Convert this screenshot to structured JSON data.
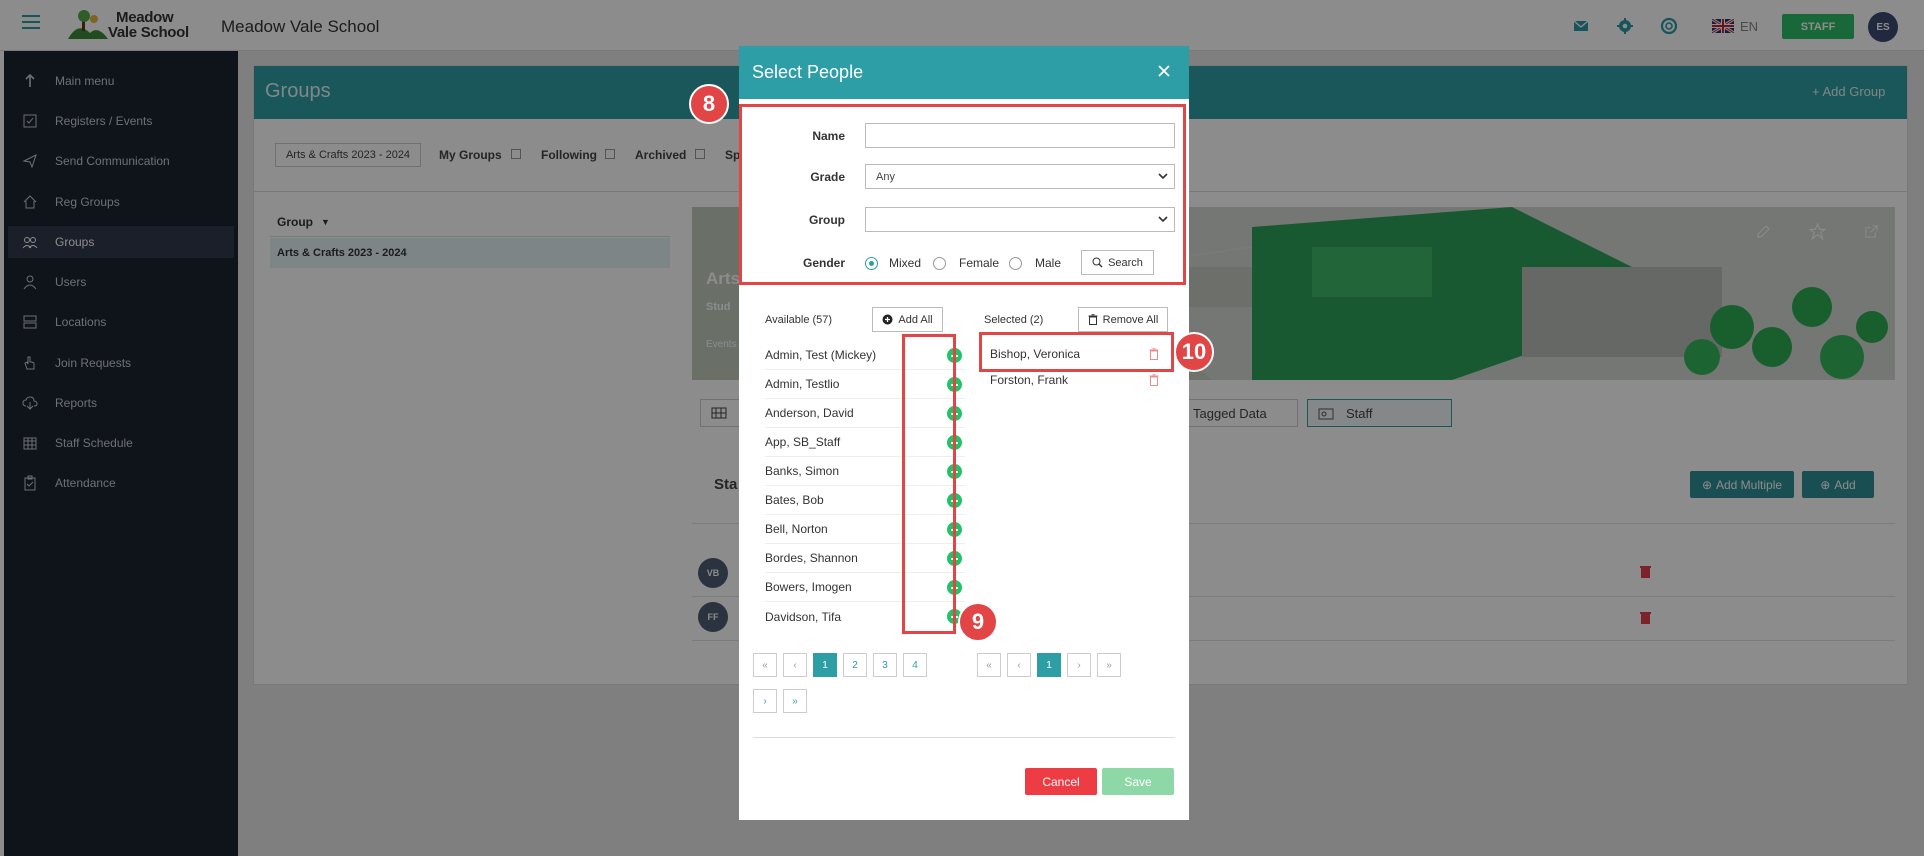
{
  "app": {
    "logo_line1": "Meadow",
    "logo_line2": "Vale School",
    "school_name": "Meadow Vale School",
    "language": "EN",
    "role_badge": "STAFF",
    "user_initials": "ES"
  },
  "sidebar": {
    "items": [
      {
        "label": "Main menu",
        "icon": "arrow-up-icon"
      },
      {
        "label": "Registers / Events",
        "icon": "checkbox-icon"
      },
      {
        "label": "Send Communication",
        "icon": "send-icon"
      },
      {
        "label": "Reg Groups",
        "icon": "home-icon"
      },
      {
        "label": "Groups",
        "icon": "people-icon"
      },
      {
        "label": "Users",
        "icon": "user-icon"
      },
      {
        "label": "Locations",
        "icon": "server-icon"
      },
      {
        "label": "Join Requests",
        "icon": "hand-icon"
      },
      {
        "label": "Reports",
        "icon": "cloud-download-icon"
      },
      {
        "label": "Staff Schedule",
        "icon": "calendar-icon"
      },
      {
        "label": "Attendance",
        "icon": "clipboard-icon"
      }
    ]
  },
  "groups_page": {
    "title": "Groups",
    "add_group": "+ Add Group",
    "filter_value": "Arts & Crafts 2023 - 2024",
    "filters": [
      "My Groups",
      "Following",
      "Archived",
      "Sp"
    ],
    "table_header": "Group",
    "table_rows": [
      "Arts & Crafts 2023 - 2024"
    ],
    "banner_title": "Arts",
    "banner_sub": "Stud",
    "banner_events": "Events",
    "tagged_data": "Tagged Data",
    "staff_tab": "Staff",
    "section_label": "Sta",
    "add_multiple": "Add Multiple",
    "add": "Add",
    "people_initials": [
      "VB",
      "FF"
    ]
  },
  "modal": {
    "title": "Select People",
    "form": {
      "name_label": "Name",
      "name_value": "",
      "grade_label": "Grade",
      "grade_value": "Any",
      "group_label": "Group",
      "group_value": "",
      "gender_label": "Gender",
      "gender_options": [
        "Mixed",
        "Female",
        "Male"
      ],
      "gender_selected": "Mixed",
      "search_button": "Search"
    },
    "available": {
      "heading": "Available (57)",
      "add_all": "Add All",
      "items": [
        "Admin, Test (Mickey)",
        "Admin, Testlio",
        "Anderson, David",
        "App, SB_Staff",
        "Banks, Simon",
        "Bates, Bob",
        "Bell, Norton",
        "Bordes, Shannon",
        "Bowers, Imogen",
        "Davidson, Tifa"
      ],
      "pages": [
        "«",
        "‹",
        "1",
        "2",
        "3",
        "4",
        "›",
        "»"
      ],
      "current_page": "1"
    },
    "selected": {
      "heading": "Selected (2)",
      "remove_all": "Remove All",
      "items": [
        "Bishop, Veronica",
        "Forston, Frank"
      ],
      "pages": [
        "«",
        "‹",
        "1",
        "›",
        "»"
      ],
      "current_page": "1"
    },
    "cancel": "Cancel",
    "save": "Save"
  },
  "annotations": {
    "badge_8": "8",
    "badge_9": "9",
    "badge_10": "10",
    "color": "#e14545"
  },
  "colors": {
    "accent": "#2e9ea6",
    "sidebar": "#1d2532",
    "add_green": "#22c267",
    "danger": "#ee3c45",
    "save_disabled": "#8ed8a7"
  }
}
